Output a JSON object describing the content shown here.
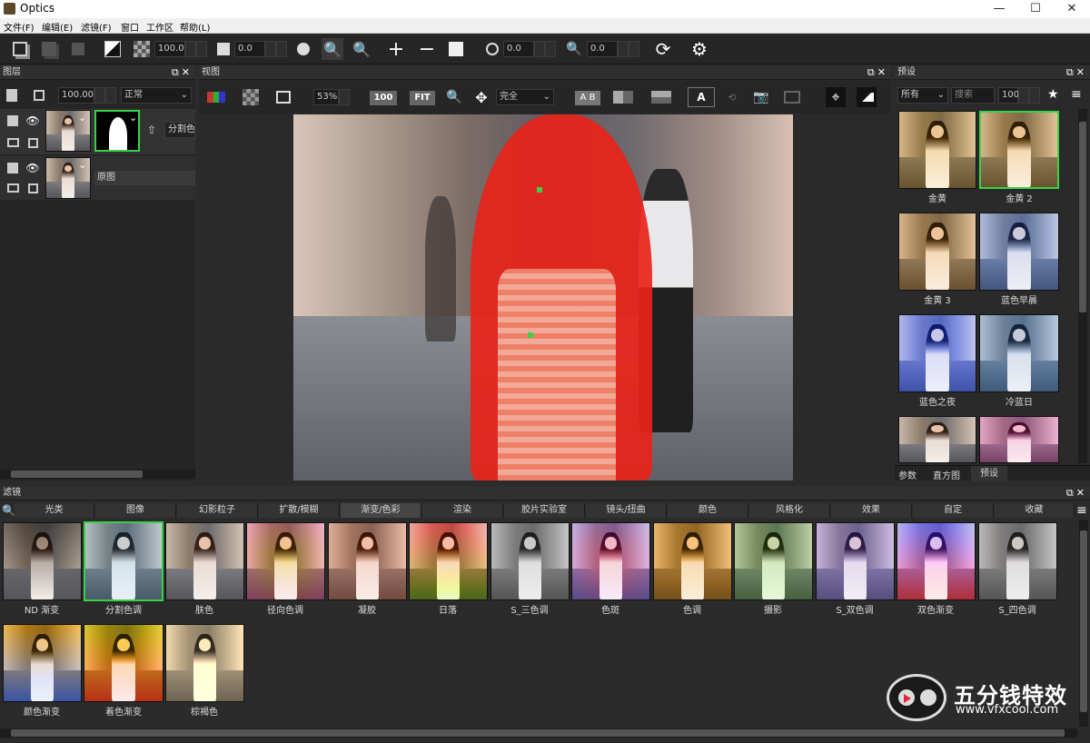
{
  "window": {
    "title": "Optics"
  },
  "menu": [
    "文件(F)",
    "编辑(E)",
    "滤镜(F)",
    "窗口",
    "工作区",
    "帮助(L)"
  ],
  "toolbar": {
    "opacity": "100.0",
    "val2": "0.0",
    "val3": "0.0",
    "val4": "0.0"
  },
  "layers": {
    "title": "图层",
    "opacity": "100.00",
    "blend": "正常",
    "layer1": "分割色",
    "layer2": "原图"
  },
  "viewer": {
    "title": "视图",
    "zoom": "53%",
    "btn100": "100",
    "btnfit": "FIT",
    "mode": "完全",
    "ab": "A B"
  },
  "presets": {
    "title": "预设",
    "filter": "所有",
    "search_placeholder": "搜索",
    "size": "100",
    "items": [
      "金黄",
      "金黄 2",
      "金黄 3",
      "蓝色早晨",
      "蓝色之夜",
      "冷蓝日",
      "",
      ""
    ],
    "tabs": [
      "参数",
      "直方图",
      "预设"
    ]
  },
  "filters": {
    "title": "滤镜",
    "tabs": [
      "光类",
      "图像",
      "幻影粒子",
      "扩散/模糊",
      "渐变/色彩",
      "渲染",
      "胶片实验室",
      "镜头/扭曲",
      "颜色",
      "风格化",
      "效果",
      "自定",
      "收藏"
    ],
    "items": [
      "ND 渐变",
      "分割色调",
      "肤色",
      "径向色调",
      "凝胶",
      "日落",
      "S_三色调",
      "色斑",
      "色调",
      "摄影",
      "S_双色调",
      "双色渐变",
      "S_四色调",
      "颜色渐变",
      "着色渐变",
      "棕褐色"
    ]
  },
  "watermark": {
    "text": "五分钱特效",
    "url": "www.vfxcool.com"
  },
  "colors": {
    "accent": "#38d24a",
    "mask": "#e8231a"
  }
}
